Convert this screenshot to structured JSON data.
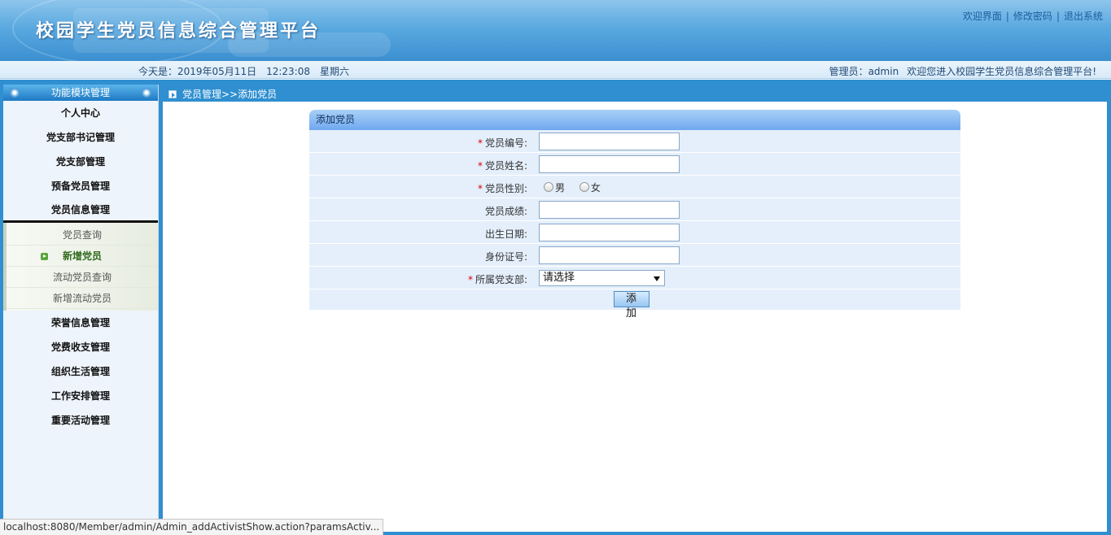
{
  "header": {
    "title": "校园学生党员信息综合管理平台",
    "links": [
      "欢迎界面",
      "修改密码",
      "退出系统"
    ]
  },
  "infobar": {
    "date_label": "今天是：2019年05月11日",
    "time": "12:23:08",
    "weekday": "星期六",
    "admin": "管理员：admin",
    "welcome": "欢迎您进入校园学生党员信息综合管理平台!"
  },
  "sidebar": {
    "title": "功能模块管理",
    "items_before": [
      "个人中心",
      "党支部书记管理",
      "党支部管理",
      "预备党员管理",
      "党员信息管理"
    ],
    "submenu": [
      "党员查询",
      "新增党员",
      "流动党员查询",
      "新增流动党员"
    ],
    "items_after": [
      "荣誉信息管理",
      "党费收支管理",
      "组织生活管理",
      "工作安排管理",
      "重要活动管理"
    ]
  },
  "breadcrumb": "党员管理>>添加党员",
  "form": {
    "title": "添加党员",
    "fields": {
      "member_no": "党员编号:",
      "name": "党员姓名:",
      "gender": "党员性别:",
      "score": "党员成绩:",
      "birth": "出生日期:",
      "id_no": "身份证号:",
      "branch": "所属党支部:"
    },
    "required_mark": "*",
    "gender_options": [
      "男",
      "女"
    ],
    "branch_selected": "请选择",
    "submit": "添 加"
  },
  "statusbar": "localhost:8080/Member/admin/Admin_addActivistShow.action?paramsActiv..."
}
